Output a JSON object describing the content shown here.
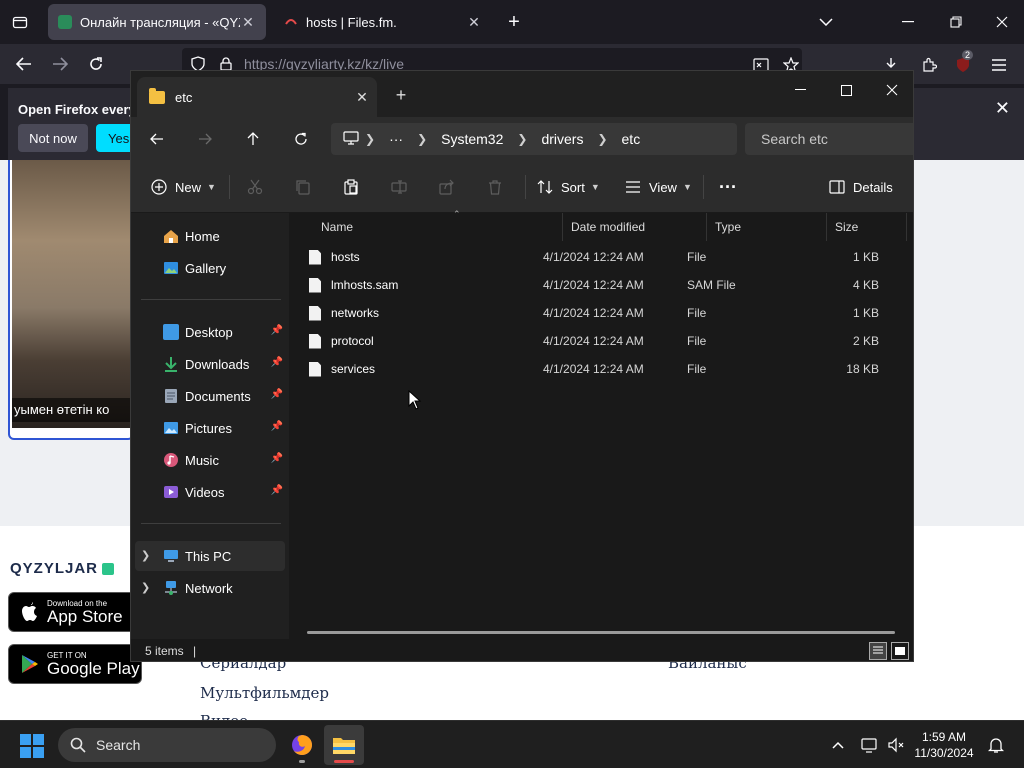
{
  "firefox": {
    "tabs": [
      {
        "title": "Онлайн трансляция - «QYZYL",
        "active": true
      },
      {
        "title": "hosts | Files.fm.",
        "active": false
      }
    ],
    "url": "https://qyzyliarty.kz/kz/live",
    "extension_badge": "2",
    "notification": {
      "title": "Open Firefox every",
      "btn_not_now": "Not now",
      "btn_yes": "Yes"
    }
  },
  "webpage": {
    "video_caption": "уымен өтетін ко",
    "brand": "QYZYLJAR",
    "appstore": {
      "small": "Download on the",
      "big": "App Store"
    },
    "googleplay": {
      "small": "GET IT ON",
      "big": "Google Play"
    },
    "links": [
      "Сериалдар",
      "Мультфильмдер",
      "Видео",
      "Байланыс"
    ]
  },
  "explorer": {
    "tab_title": "etc",
    "breadcrumb": [
      "System32",
      "drivers",
      "etc"
    ],
    "breadcrumb_more": "···",
    "search_placeholder": "Search etc",
    "commands": {
      "new": "New",
      "sort": "Sort",
      "view": "View",
      "more": "···",
      "details": "Details"
    },
    "nav": {
      "home": "Home",
      "gallery": "Gallery",
      "desktop": "Desktop",
      "downloads": "Downloads",
      "documents": "Documents",
      "pictures": "Pictures",
      "music": "Music",
      "videos": "Videos",
      "thispc": "This PC",
      "network": "Network"
    },
    "columns": {
      "name": "Name",
      "date": "Date modified",
      "type": "Type",
      "size": "Size"
    },
    "files": [
      {
        "name": "hosts",
        "date": "4/1/2024 12:24 AM",
        "type": "File",
        "size": "1 KB"
      },
      {
        "name": "lmhosts.sam",
        "date": "4/1/2024 12:24 AM",
        "type": "SAM File",
        "size": "4 KB"
      },
      {
        "name": "networks",
        "date": "4/1/2024 12:24 AM",
        "type": "File",
        "size": "1 KB"
      },
      {
        "name": "protocol",
        "date": "4/1/2024 12:24 AM",
        "type": "File",
        "size": "2 KB"
      },
      {
        "name": "services",
        "date": "4/1/2024 12:24 AM",
        "type": "File",
        "size": "18 KB"
      }
    ],
    "status": "5 items",
    "status_sep": "|"
  },
  "taskbar": {
    "search": "Search",
    "time": "1:59 AM",
    "date": "11/30/2024"
  },
  "colors": {
    "accent": "#60cdff",
    "folder": "#f4c042",
    "firefox_cta": "#00ddff",
    "brand_blue": "#2f55d4"
  }
}
